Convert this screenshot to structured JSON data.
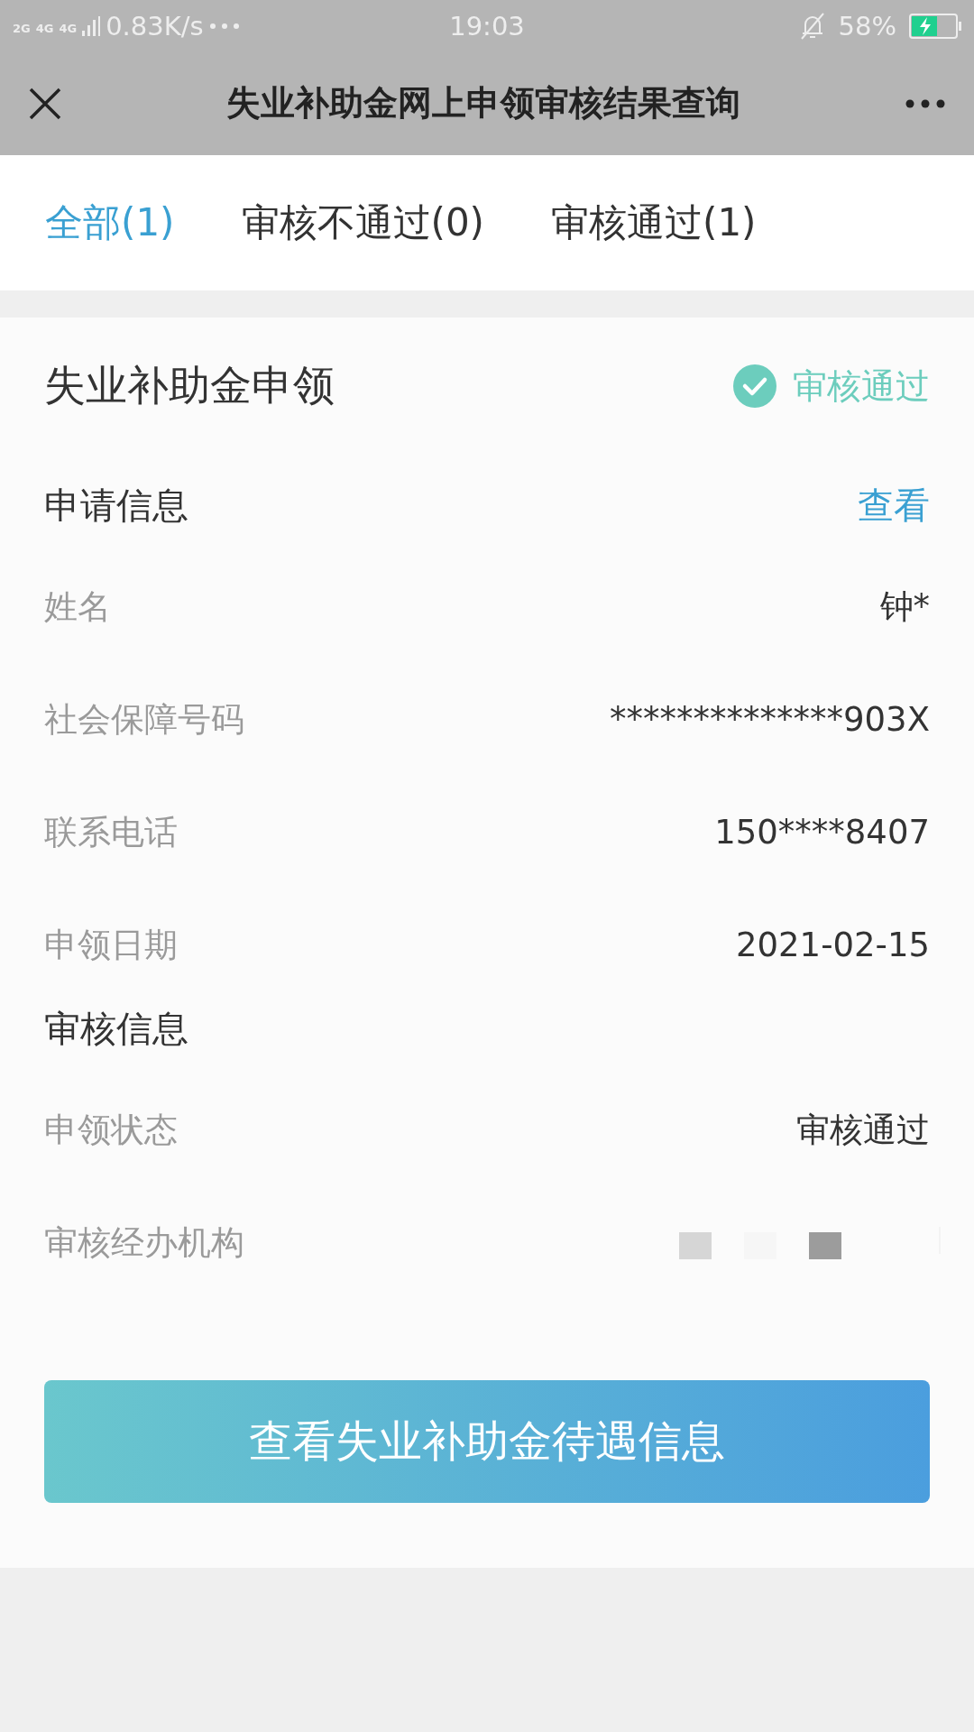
{
  "status_bar": {
    "signal_labels": [
      "2G",
      "4G",
      "4G"
    ],
    "speed": "0.83K/s",
    "time": "19:03",
    "battery": "58%",
    "charging": true
  },
  "header": {
    "title": "失业补助金网上申领审核结果查询"
  },
  "tabs": [
    {
      "label": "全部(1)",
      "selected": true
    },
    {
      "label": "审核不通过(0)",
      "selected": false
    },
    {
      "label": "审核通过(1)",
      "selected": false
    }
  ],
  "card": {
    "title": "失业补助金申领",
    "status": {
      "label": "审核通过",
      "kind": "approved"
    },
    "sections": [
      {
        "title": "申请信息",
        "action": "查看",
        "rows": [
          {
            "label": "姓名",
            "value": "钟*",
            "kind": "text"
          },
          {
            "label": "社会保障号码",
            "value": "**************903X",
            "kind": "text"
          },
          {
            "label": "联系电话",
            "value": "150****8407",
            "kind": "text"
          },
          {
            "label": "申领日期",
            "value": "2021-02-15",
            "kind": "text"
          }
        ]
      },
      {
        "title": "审核信息",
        "rows": [
          {
            "label": "申领状态",
            "value": "审核通过",
            "kind": "text"
          },
          {
            "label": "审核经办机构",
            "kind": "redacted"
          }
        ]
      }
    ],
    "button": "查看失业补助金待遇信息"
  }
}
